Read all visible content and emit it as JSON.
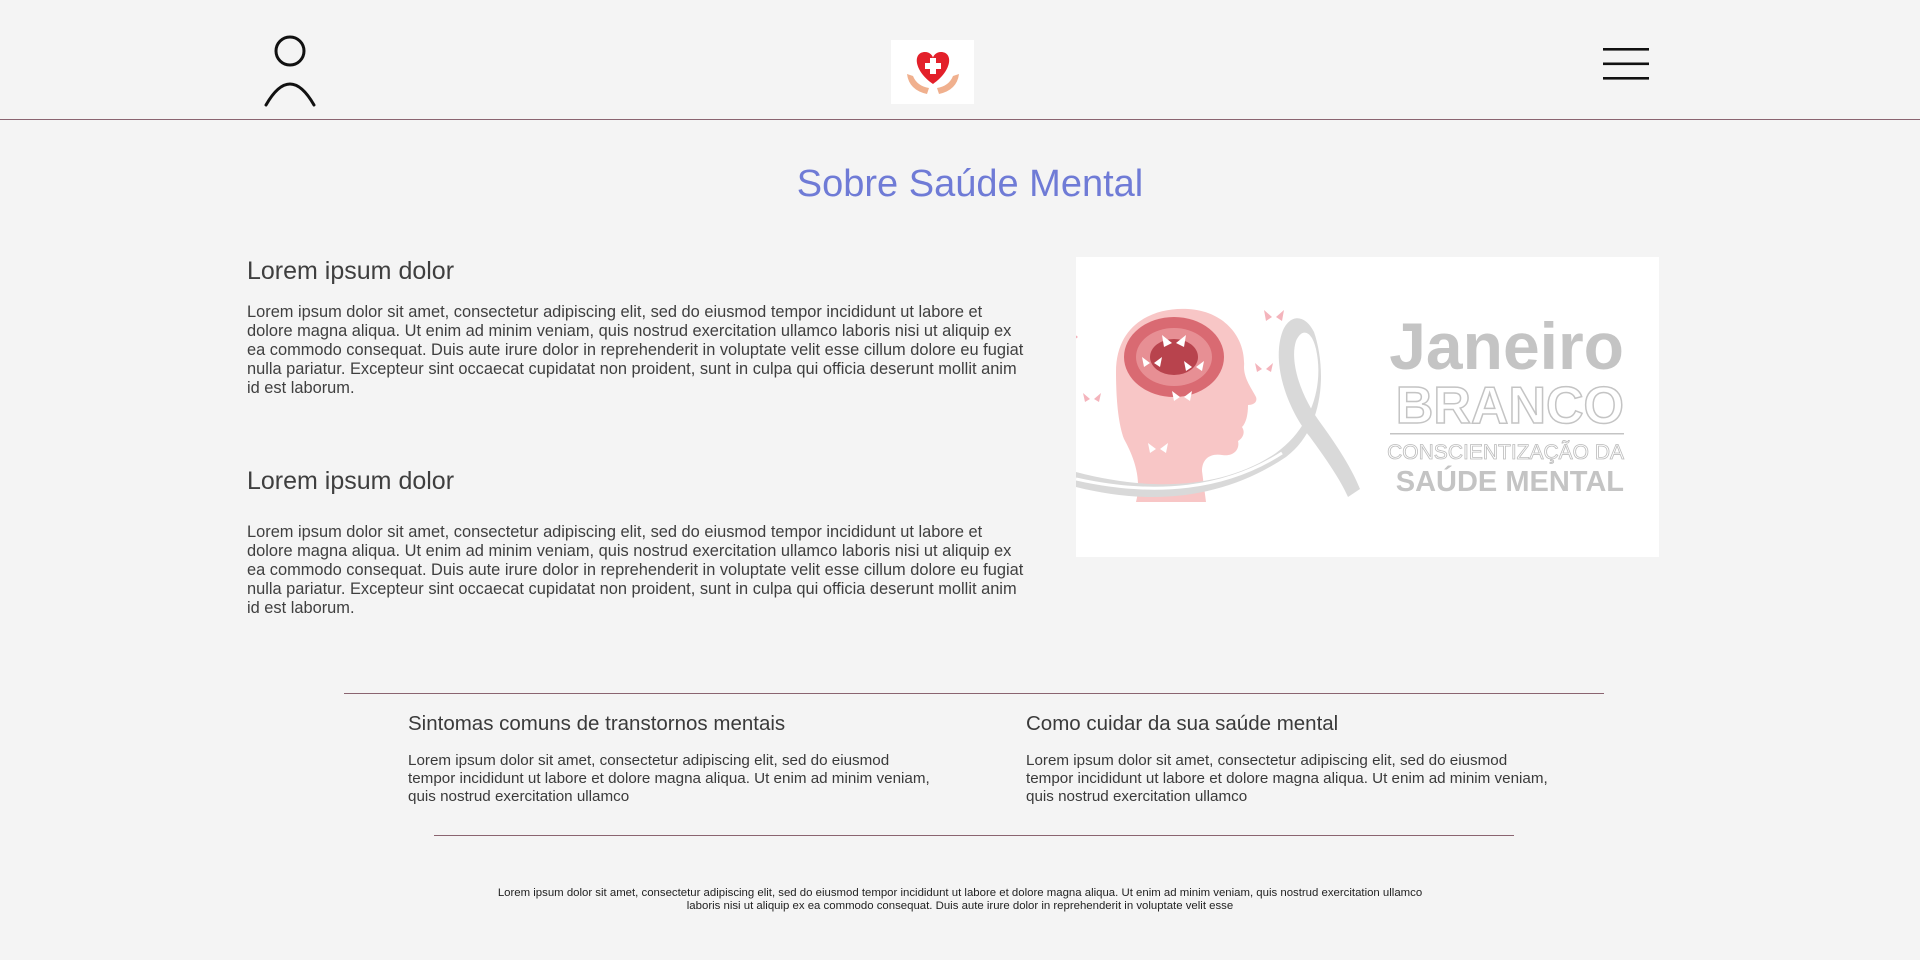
{
  "header": {
    "user_icon": "user-profile-icon",
    "logo_icon": "heart-cross-hands-icon",
    "menu_icon": "hamburger-menu-icon"
  },
  "page": {
    "title": "Sobre Saúde Mental"
  },
  "sections": [
    {
      "heading": "Lorem ipsum dolor",
      "body": "Lorem ipsum dolor sit amet, consectetur adipiscing elit, sed do eiusmod tempor incididunt ut labore et dolore magna aliqua. Ut enim ad minim veniam, quis nostrud exercitation ullamco laboris nisi ut aliquip ex ea commodo consequat. Duis aute irure dolor in reprehenderit in voluptate velit esse cillum dolore eu fugiat nulla pariatur. Excepteur sint occaecat cupidatat non proident, sunt in culpa qui officia deserunt mollit anim id est laborum."
    },
    {
      "heading": "Lorem ipsum dolor",
      "body": "Lorem ipsum dolor sit amet, consectetur adipiscing elit, sed do eiusmod tempor incididunt ut labore et dolore magna aliqua. Ut enim ad minim veniam, quis nostrud exercitation ullamco laboris nisi ut aliquip ex ea commodo consequat. Duis aute irure dolor in reprehenderit in voluptate velit esse cillum dolore eu fugiat nulla pariatur. Excepteur sint occaecat cupidatat non proident, sunt in culpa qui officia deserunt mollit anim id est laborum."
    }
  ],
  "hero_image": {
    "line1": "Janeiro",
    "line2": "BRANCO",
    "line3": "CONSCIENTIZAÇÃO DA",
    "line4": "SAÚDE MENTAL"
  },
  "cards": [
    {
      "title": "Sintomas comuns de transtornos mentais",
      "body": "Lorem ipsum dolor sit amet, consectetur adipiscing elit, sed do eiusmod tempor incididunt ut labore et dolore magna aliqua. Ut enim ad minim veniam, quis nostrud exercitation ullamco"
    },
    {
      "title": "Como cuidar da sua saúde mental",
      "body": "Lorem ipsum dolor sit amet, consectetur adipiscing elit, sed do eiusmod tempor incididunt ut labore et dolore magna aliqua. Ut enim ad minim veniam, quis nostrud exercitation ullamco"
    }
  ],
  "footer": {
    "text": "Lorem ipsum dolor sit amet, consectetur adipiscing elit, sed do eiusmod tempor incididunt ut labore et dolore magna aliqua. Ut enim ad minim veniam, quis nostrud exercitation ullamco laboris nisi ut aliquip ex ea commodo consequat. Duis aute irure dolor in reprehenderit in voluptate velit esse"
  },
  "colors": {
    "background": "#f4f4f4",
    "title_accent": "#6f7bd6",
    "divider": "#8a6470",
    "logo_heart": "#e3202a",
    "hands": "#f0b08e"
  }
}
